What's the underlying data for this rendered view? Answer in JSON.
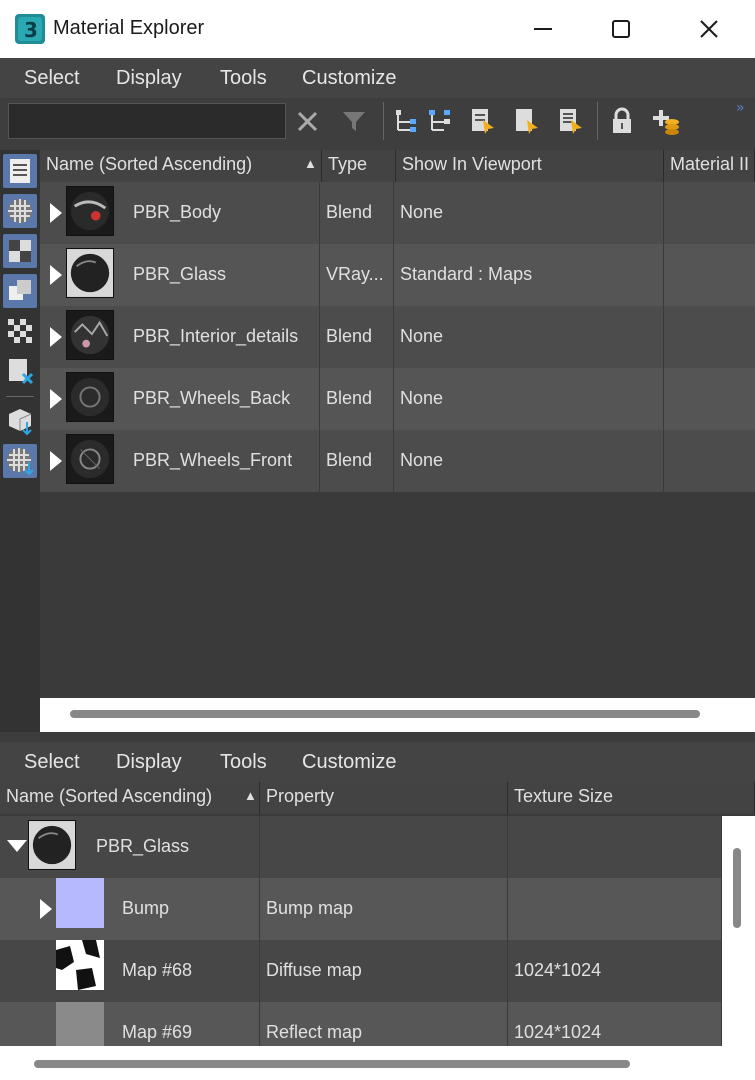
{
  "window": {
    "title": "Material Explorer",
    "app_icon": "3ds-max-icon"
  },
  "top_menu": [
    "Select",
    "Display",
    "Tools",
    "Customize"
  ],
  "toolbar": {
    "search_value": "",
    "overflow": "»"
  },
  "upper_table": {
    "columns": [
      "Name (Sorted Ascending)",
      "Type",
      "Show In Viewport",
      "Material II"
    ],
    "sort_indicator": "▲",
    "rows": [
      {
        "name": "PBR_Body",
        "type": "Blend",
        "viewport": "None"
      },
      {
        "name": "PBR_Glass",
        "type": "VRay...",
        "viewport": "Standard : Maps"
      },
      {
        "name": "PBR_Interior_details",
        "type": "Blend",
        "viewport": "None"
      },
      {
        "name": "PBR_Wheels_Back",
        "type": "Blend",
        "viewport": "None"
      },
      {
        "name": "PBR_Wheels_Front",
        "type": "Blend",
        "viewport": "None"
      }
    ]
  },
  "bottom_menu": [
    "Select",
    "Display",
    "Tools",
    "Customize"
  ],
  "lower_table": {
    "columns": [
      "Name (Sorted Ascending)",
      "Property",
      "Texture Size"
    ],
    "sort_indicator": "▲",
    "root": {
      "name": "PBR_Glass"
    },
    "rows": [
      {
        "name": "Bump",
        "property": "Bump map",
        "size": "",
        "swatch": "#b7b9ff"
      },
      {
        "name": "Map #68",
        "property": "Diffuse map",
        "size": "1024*1024",
        "swatch": "#ffffff"
      },
      {
        "name": "Map #69",
        "property": "Reflect map",
        "size": "1024*1024",
        "swatch": "#8a8a8a"
      }
    ]
  },
  "colors": {
    "accent": "#5a78aa",
    "sort_arrow": "#ffffff"
  }
}
